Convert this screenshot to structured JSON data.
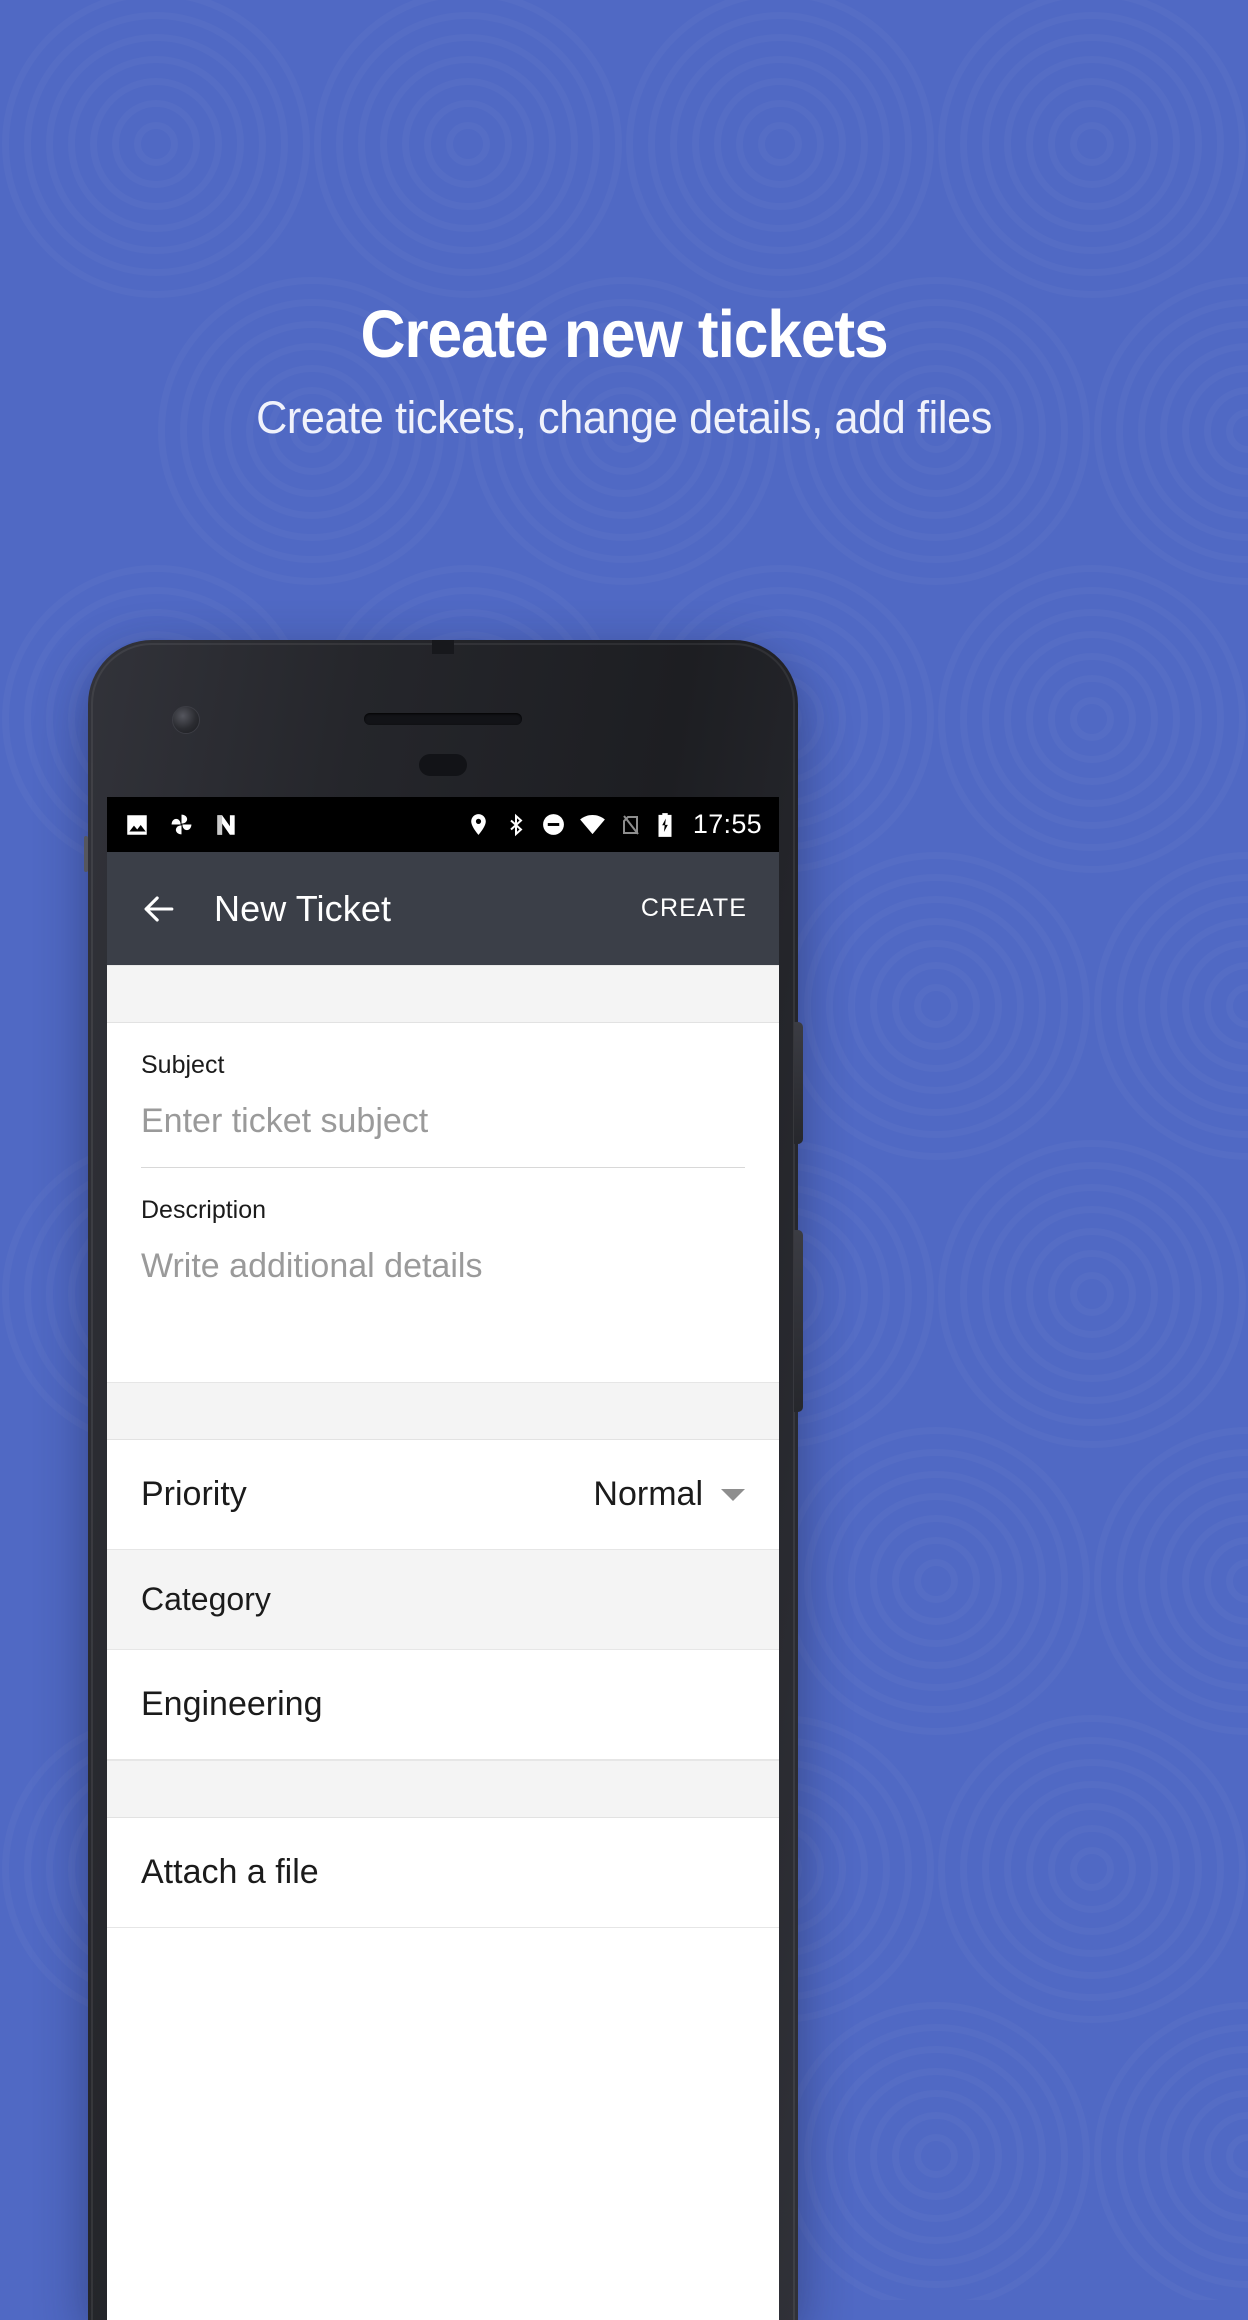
{
  "theme": {
    "background": "#5069c4",
    "app_bar": "#3b3f48",
    "status_bar": "#000000",
    "surface": "#ffffff",
    "divider_band": "#f4f4f4",
    "placeholder_text": "#9a9a9a",
    "primary_text": "#1b1b1b"
  },
  "promo": {
    "headline": "Create new tickets",
    "subheadline": "Create tickets, change details, add files"
  },
  "status_bar": {
    "left_icons": [
      "image-icon",
      "photos-pinwheel-icon",
      "n-app-icon"
    ],
    "right_icons": [
      "location-pin-icon",
      "bluetooth-icon",
      "do-not-disturb-icon",
      "wifi-icon",
      "no-sim-icon",
      "battery-charging-icon"
    ],
    "clock": "17:55"
  },
  "app_bar": {
    "back_label": "←",
    "title": "New Ticket",
    "action_label": "CREATE"
  },
  "form": {
    "subject": {
      "label": "Subject",
      "placeholder": "Enter ticket subject",
      "value": ""
    },
    "description": {
      "label": "Description",
      "placeholder": "Write additional details",
      "value": ""
    },
    "priority": {
      "label": "Priority",
      "value": "Normal",
      "options": [
        "Normal"
      ]
    },
    "category": {
      "header": "Category",
      "value": "Engineering"
    },
    "attachment": {
      "label": "Attach a file"
    }
  }
}
